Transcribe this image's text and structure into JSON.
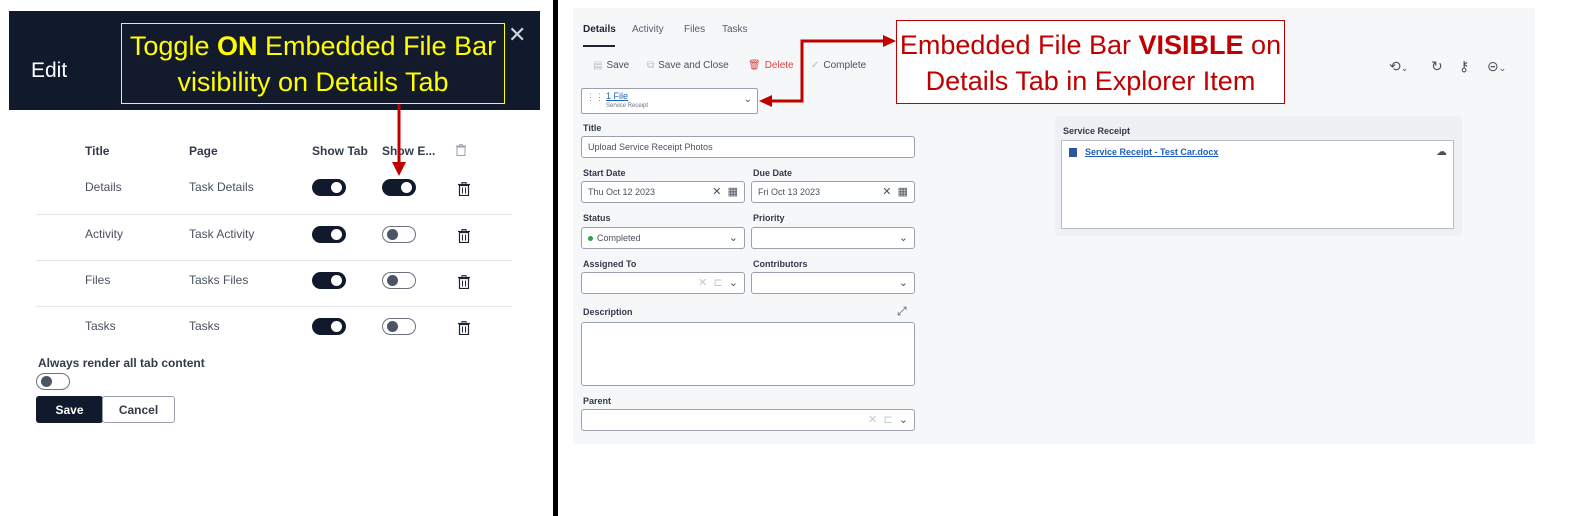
{
  "edit_dialog": {
    "title": "Edit",
    "columns": {
      "title": "Title",
      "page": "Page",
      "show_tab": "Show Tab",
      "show_embedded": "Show E..."
    },
    "rows": [
      {
        "title": "Details",
        "page": "Task Details",
        "show_tab": true,
        "show_embedded": true
      },
      {
        "title": "Activity",
        "page": "Task Activity",
        "show_tab": true,
        "show_embedded": false
      },
      {
        "title": "Files",
        "page": "Tasks Files",
        "show_tab": true,
        "show_embedded": false
      },
      {
        "title": "Tasks",
        "page": "Tasks",
        "show_tab": true,
        "show_embedded": false
      }
    ],
    "always_render_label": "Always render all tab content",
    "always_render": false,
    "save_label": "Save",
    "cancel_label": "Cancel"
  },
  "callouts": {
    "left": {
      "line1_pre": "Toggle ",
      "line1_bold": "ON",
      "line1_post": " Embedded File Bar",
      "line2": "visibility on Details Tab"
    },
    "right": {
      "line1_pre": "Embedded File Bar ",
      "line1_bold": "VISIBLE",
      "line1_post": " on",
      "line2": "Details Tab in Explorer Item"
    }
  },
  "explorer_item": {
    "tabs": [
      "Details",
      "Activity",
      "Files",
      "Tasks"
    ],
    "toolbar": {
      "save": "Save",
      "save_close": "Save and Close",
      "delete": "Delete",
      "complete": "Complete"
    },
    "file_bar": {
      "link": "1 File",
      "sub": "Service Receipt"
    },
    "form": {
      "title_label": "Title",
      "title_value": "Upload Service Receipt Photos",
      "start_label": "Start Date",
      "start_value": "Thu Oct 12 2023",
      "due_label": "Due Date",
      "due_value": "Fri Oct 13 2023",
      "status_label": "Status",
      "status_value": "Completed",
      "priority_label": "Priority",
      "assigned_label": "Assigned To",
      "contributors_label": "Contributors",
      "description_label": "Description",
      "parent_label": "Parent"
    },
    "attachments": {
      "title": "Service Receipt",
      "file": "Service Receipt - Test Car.docx"
    }
  },
  "colors": {
    "navy": "#111a2c",
    "callout_yellow": "#ffff00",
    "callout_red": "#c00000",
    "status_green": "#2e9e4f"
  }
}
